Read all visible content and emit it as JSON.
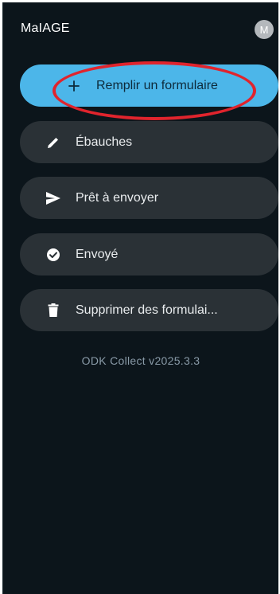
{
  "app": {
    "title": "MaIAGE",
    "avatar_initial": "M"
  },
  "menu": {
    "fill_form": {
      "label": "Remplir un formulaire",
      "icon": "plus-icon"
    },
    "drafts": {
      "label": "Ébauches",
      "icon": "pencil-icon"
    },
    "ready_to_send": {
      "label": "Prêt à envoyer",
      "icon": "send-icon"
    },
    "sent": {
      "label": "Envoyé",
      "icon": "check-circle-icon"
    },
    "delete_forms": {
      "label": "Supprimer des formulai...",
      "icon": "trash-icon"
    }
  },
  "footer": {
    "version": "ODK Collect v2025.3.3"
  },
  "colors": {
    "background": "#0c151b",
    "primary_button": "#4cb6e9",
    "secondary_button": "#2a3136",
    "highlight_ring": "#e0242d"
  }
}
